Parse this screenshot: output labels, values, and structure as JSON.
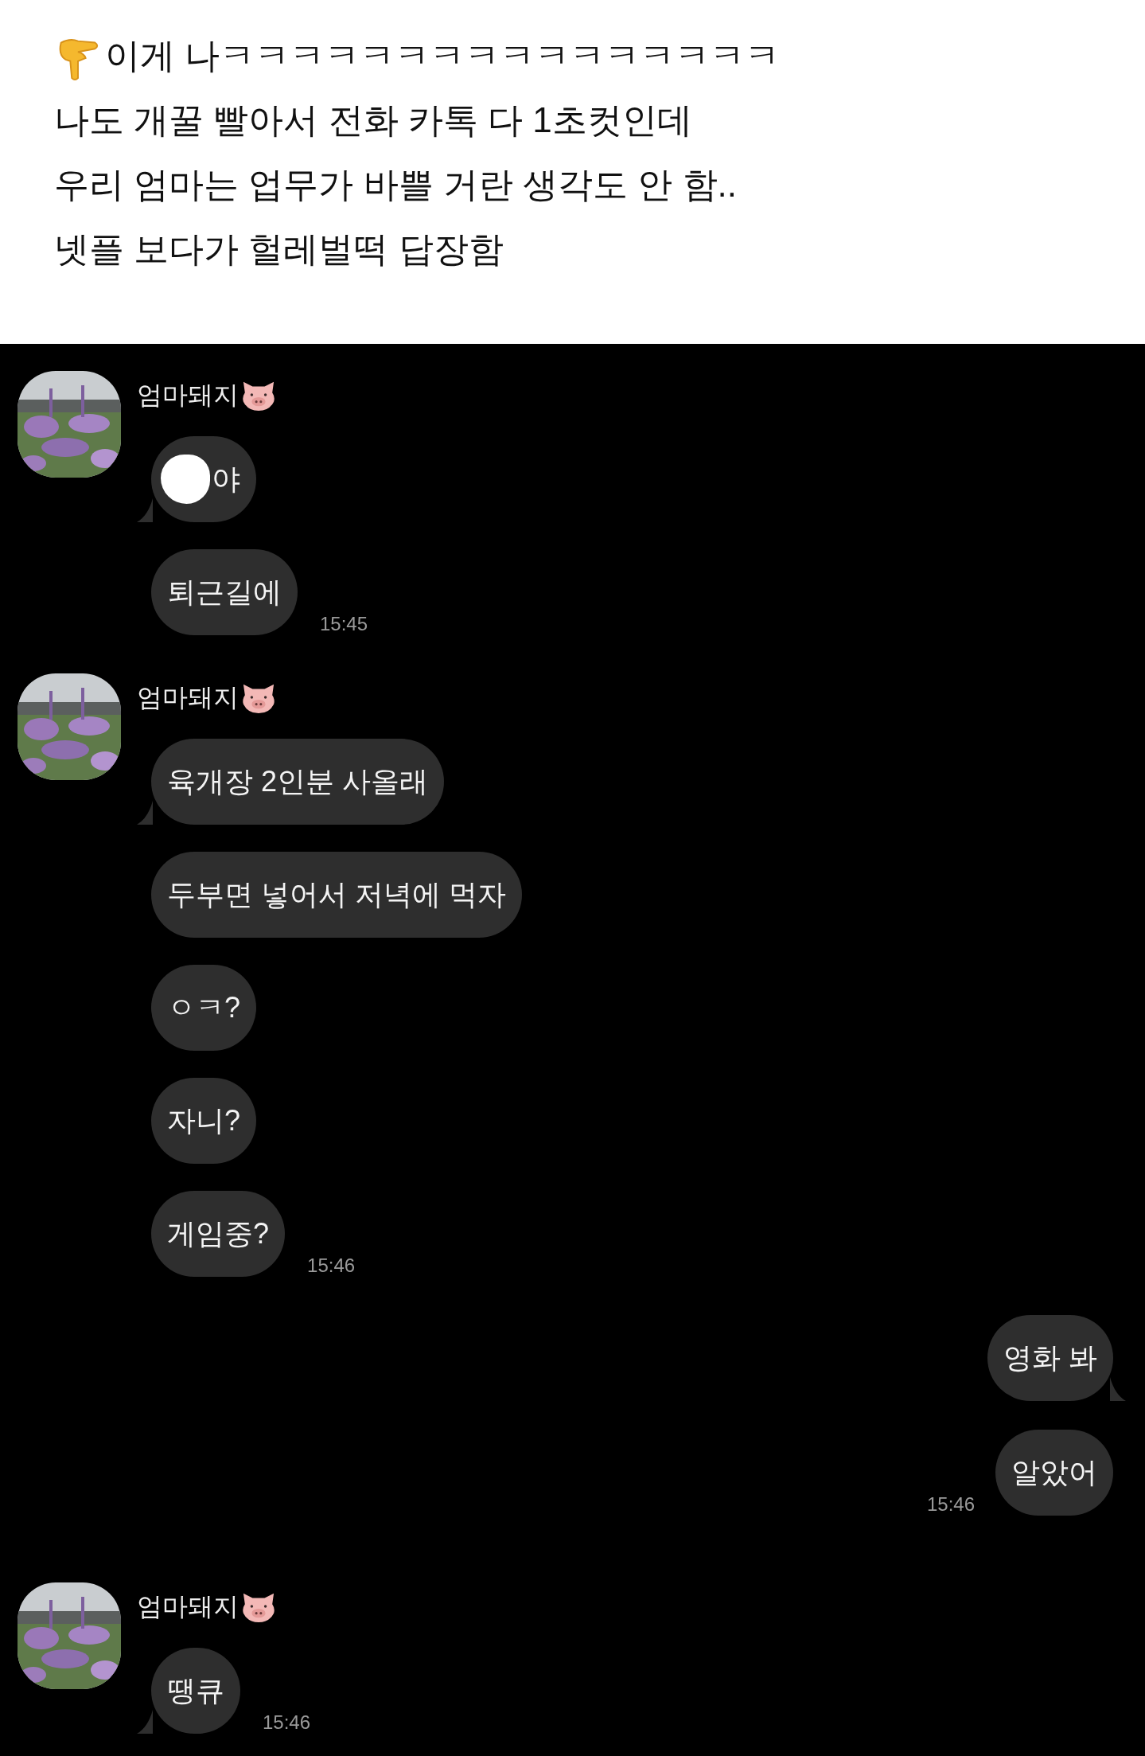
{
  "caption": {
    "lines": [
      "이게 나ㅋㅋㅋㅋㅋㅋㅋㅋㅋㅋㅋㅋㅋㅋㅋㅋ",
      "나도 개꿀 빨아서 전화 카톡 다 1초컷인데",
      "우리 엄마는 업무가 바쁠 거란 생각도 안 함..",
      "넷플 보다가 헐레벌떡 답장함"
    ]
  },
  "chat": {
    "groups": [
      {
        "kind": "incoming",
        "sender": "엄마돼지",
        "messages": [
          {
            "text": "야",
            "redacted": true
          },
          {
            "text": "퇴근길에",
            "time": "15:45"
          }
        ]
      },
      {
        "kind": "incoming",
        "sender": "엄마돼지",
        "messages": [
          {
            "text": "육개장 2인분 사올래"
          },
          {
            "text": "두부면 넣어서 저녁에 먹자"
          },
          {
            "text": "ㅇㅋ?"
          },
          {
            "text": "자니?"
          },
          {
            "text": "게임중?",
            "time": "15:46"
          }
        ]
      },
      {
        "kind": "outgoing",
        "messages": [
          {
            "text": "영화 봐"
          },
          {
            "text": "알았어",
            "time": "15:46"
          }
        ]
      },
      {
        "kind": "incoming",
        "sender": "엄마돼지",
        "messages": [
          {
            "text": "땡큐",
            "time": "15:46"
          }
        ]
      }
    ]
  }
}
